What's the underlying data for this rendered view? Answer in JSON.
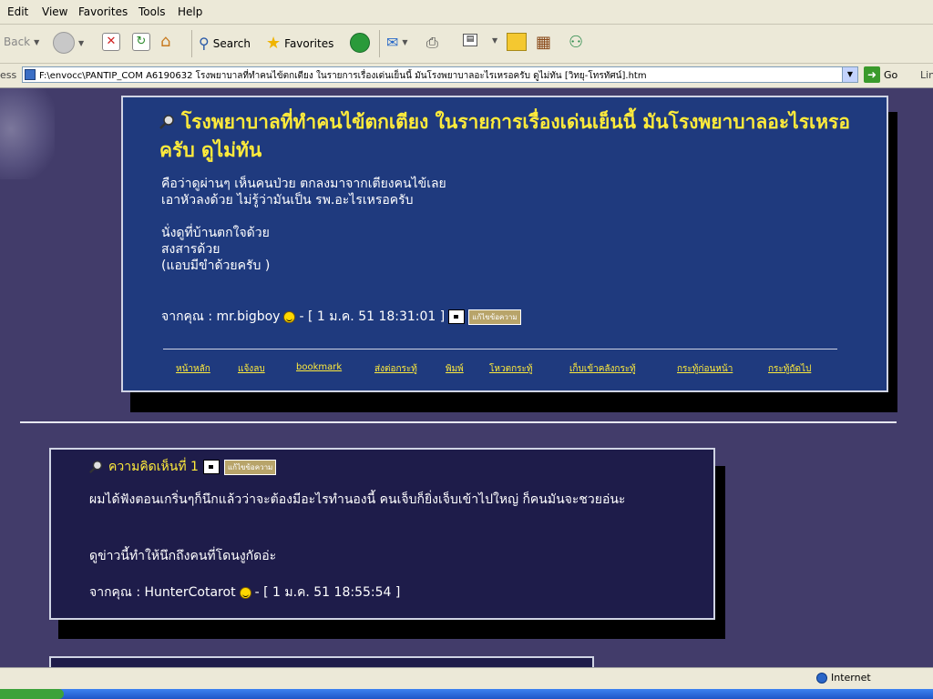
{
  "menu": [
    "Edit",
    "View",
    "Favorites",
    "Tools",
    "Help"
  ],
  "toolbar": {
    "back_label": "Back",
    "search_label": "Search",
    "favorites_label": "Favorites"
  },
  "address": {
    "label": "ess",
    "value": "F:\\envocc\\PANTIP_COM A6190632 โรงพยาบาลที่ทำคนไข้ตกเตียง ในรายการเรื่องเด่นเย็นนี้ มันโรงพยาบาลอะไรเหรอครับ ดูไม่ทัน [วิทยุ-โทรทัศน์].htm",
    "go_label": "Go",
    "links_label": "Lin"
  },
  "post": {
    "title": "โรงพยาบาลที่ทำคนไข้ตกเตียง ในรายการเรื่องเด่นเย็นนี้ มันโรงพยาบาลอะไรเหรอครับ ดูไม่ทัน",
    "lines": [
      "คือว่าดูผ่านๆ   เห็นคนป่วย ตกลงมาจากเตียงคนไข้เลย",
      "เอาหัวลงด้วย   ไม่รู้ว่ามันเป็น รพ.อะไรเหรอครับ",
      "",
      "นั่งดูที่บ้านตกใจด้วย",
      "สงสารด้วย",
      "(แอบมีขำด้วยครับ )"
    ],
    "author_prefix": "จากคุณ : mr.bigboy",
    "timestamp": "- [ 1 ม.ค. 51 18:31:01 ]",
    "edit_label": "แก้ไขข้อความ",
    "links": [
      "หน้าหลัก",
      "แจ้งลบ",
      "bookmark",
      "ส่งต่อกระทู้",
      "พิมพ์",
      "โหวตกระทู้",
      "เก็บเข้าคลังกระทู้",
      "กระทู้ก่อนหน้า",
      "กระทู้ถัดไป"
    ]
  },
  "comment": {
    "title": "ความคิดเห็นที่ 1",
    "edit_label": "แก้ไขข้อความ",
    "lines": [
      "ผมได้ฟังตอนเกริ่นๆก็นึกแล้วว่าจะต้องมีอะไรทำนองนี้ คนเจ็บก็ยิ่งเจ็บเข้าไปใหญ่ ก็คนมันจะชวยอ่นะ",
      "",
      "",
      "ดูข่าวนี้ทำให้นึกถึงคนที่โดนงูกัดอ่ะ"
    ],
    "author_prefix": "จากคุณ : HunterCotarot",
    "timestamp": "- [ 1 ม.ค. 51 18:55:54 ]"
  },
  "status": {
    "zone_label": "Internet"
  }
}
